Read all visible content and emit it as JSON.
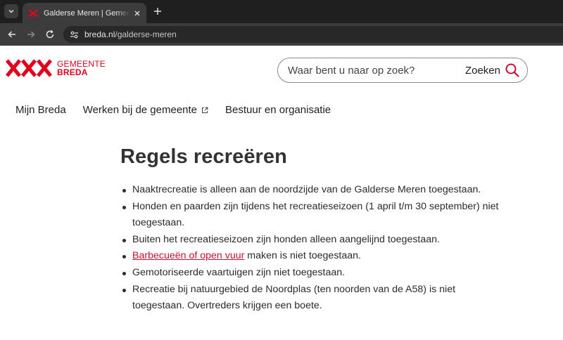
{
  "browser": {
    "tab_title": "Galderse Meren | Gemeente Breda",
    "url_domain": "breda.nl",
    "url_path": "/galderse-meren"
  },
  "header": {
    "logo_line1": "GEMEENTE",
    "logo_line2": "BREDA",
    "search_placeholder": "Waar bent u naar op zoek?",
    "search_button": "Zoeken",
    "brand_color": "#e3001b"
  },
  "nav": {
    "items": [
      {
        "label": "Mijn Breda"
      },
      {
        "label": "Werken bij de gemeente",
        "external": true
      },
      {
        "label": "Bestuur en organisatie"
      }
    ]
  },
  "content": {
    "title": "Regels recreëren",
    "rules": [
      {
        "text": "Naaktrecreatie is alleen aan de noordzijde van de Galderse Meren toegestaan."
      },
      {
        "text": "Honden en paarden zijn tijdens het recreatieseizoen (1 april t/m 30 september) niet toegestaan."
      },
      {
        "text": "Buiten het recreatieseizoen zijn honden alleen aangelijnd toegestaan."
      },
      {
        "link": "Barbecueën of open vuur",
        "text": " maken is niet toegestaan."
      },
      {
        "text": "Gemotoriseerde vaartuigen zijn niet toegestaan."
      },
      {
        "text": "Recreatie bij natuurgebied de Noordplas (ten noorden van de A58) is niet toegestaan. Overtreders krijgen een boete."
      }
    ],
    "link_color": "#c8102e"
  }
}
